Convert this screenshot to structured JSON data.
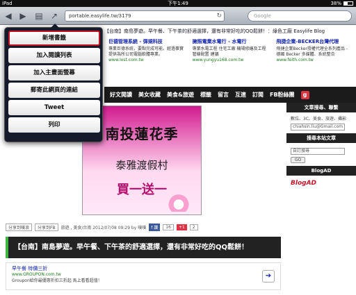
{
  "status_bar": {
    "carrier": "iPad",
    "time": "下午1:49",
    "battery": "38%"
  },
  "toolbar": {
    "url": "portable.easylife.tw/3179",
    "search_placeholder": "Google"
  },
  "page": {
    "blog_topline": "【台南】南島夢遊。早午餐、下午茶的舒適選擇，還有非常好吃的QQ鬆餅！：綠色工廠 Easylife Blog",
    "ads": [
      {
        "title": "巨德管理系統 - 彈規科技",
        "desc": "專業巨德系統，要點完成可能。經過事實提供為所公司電腦軟體專業。",
        "url": "www.lost.com.tw"
      },
      {
        "title": "擁照電業水電行 - 水電行",
        "desc": "專業水電工程 住宅工廠 機場修繕及工程 管線配置 建議",
        "url": "www.yungyu168.com.tw"
      },
      {
        "title": "飛捷企業-BECKER台灣代理",
        "desc": "飛捷企業Becker授權代理全系列產品 - 德國 Becker 多媒體、系統整合",
        "url": "www.feith.com.tw"
      }
    ],
    "nav": [
      "好文閱讀",
      "美女收藏",
      "美食&旅遊",
      "標籤",
      "留言",
      "互連",
      "訂閱",
      "FB粉絲團"
    ],
    "post_image": {
      "title": "南投蓮花季",
      "sub": "泰雅渡假村",
      "promo": "買一送一"
    },
    "share_row": {
      "facebook": "分享到噗浪",
      "share_fb": "分享到FB",
      "meta": "旅遊 , 美食/台南  2012/07/08 09:29 by 噗噗",
      "like_count": "16",
      "plus_count": "2"
    },
    "post_title": "【台南】南島夢遊。早午餐、下午茶的舒適選擇，還有非常好吃的QQ鬆餅！",
    "ad_unit": {
      "title": "早午餐 特價三折",
      "url": "www.GROUPON.com.tw",
      "desc": "Groupon給你最優惠折扣三折起 馬上看看超值！"
    },
    "sidebar": {
      "head1": "文章搜尋、聯繫",
      "search_hint": "數位、3C、美食、旅遊、攝影",
      "email": "chiahsin.liu@Gmail.com",
      "head2": "搜尋本站文章",
      "google": "自訂搜尋",
      "go": "GO",
      "head3": "BlogAD",
      "blogad": "BlogAD"
    }
  },
  "popover": {
    "items": [
      {
        "label": "新增書籤",
        "selected": true
      },
      {
        "label": "加入閱讀列表"
      },
      {
        "label": "加入主畫面螢幕"
      },
      {
        "label": "郵寄此網頁的連結"
      },
      {
        "label": "Tweet"
      },
      {
        "label": "列印"
      }
    ]
  }
}
